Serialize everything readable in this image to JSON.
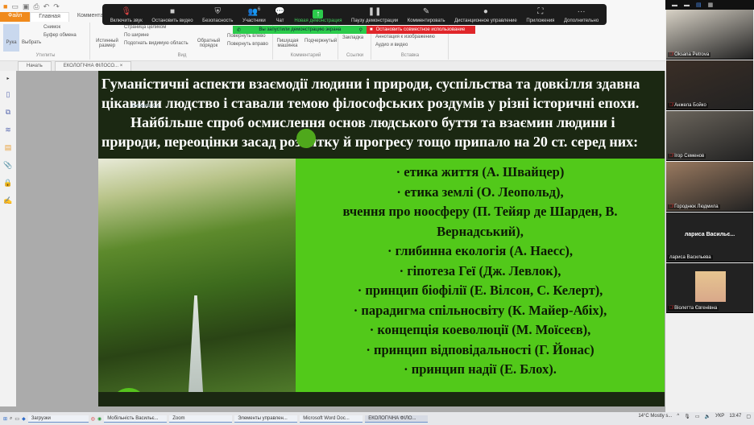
{
  "ribbon": {
    "tabs": [
      "Файл",
      "Главная",
      "Комментарий"
    ],
    "tools": {
      "hand": "Рука",
      "select": "Выбрать",
      "snapshot": "Снимок",
      "clipboard": "Буфер обмена",
      "group": "Утилиты"
    },
    "view": {
      "actual_size": "Истинный размер",
      "full_page": "Страница целиком",
      "fit_width": "По ширине",
      "fit_visible": "Подогнать видимую область",
      "reverse": "Обратный порядок",
      "rotate_left": "Повернуть влево",
      "rotate_right": "Повернуть вправо",
      "group": "Вид"
    },
    "comment": {
      "typewriter": "Пишущая машинка",
      "highlight": "Подчеркнутый",
      "group": "Комментарий"
    },
    "links": {
      "bookmark": "Закладка",
      "group": "Ссылки"
    },
    "insert": {
      "annotation": "Аннотация к изображению",
      "audio": "Аудио и видео",
      "group": "Вставка"
    }
  },
  "zoom_toolbar": {
    "items": [
      "Включить звук",
      "Остановить видео",
      "Безопасность",
      "Участники",
      "Чат",
      "Новая демонстрация",
      "Паузу демонстрации",
      "Комментировать",
      "Дистанционное управление",
      "Приложения",
      "Дополнительно"
    ],
    "participants_count": "6",
    "share_banner": "Вы запустили демонстрацию экрана",
    "stop_share": "Остановить совместное использование"
  },
  "doc_tabs": [
    "Начать",
    "ЕКОЛОГІЧНА ФІЛОСО..."
  ],
  "slide": {
    "head": [
      "Гуманістичні аспекти взаємодії людини і природи, суспільства та довкілля здавна цікавили людство і ставали темою філософських роздумів у різні історичні епохи.",
      "Найбільше спроб осмислення основ людського буття та взаємин людини і природи, переоцінки засад розвитку й прогресу тощо припало на 20 ст. серед них:"
    ],
    "logo": "Bimberia Co",
    "items": [
      "·     етика життя (А. Швайцер)",
      "·     етика землі (О. Леопольд),",
      "вчення про ноосферу (П. Тейяр де Шарден, В. Вернадський),",
      "·     глибинна екологія (А. Наесс),",
      "·     гіпотеза Геї (Дж. Левлок),",
      "·     принцип біофілії (Е. Вілсон, С. Келерт),",
      "·     парадигма спільносвіту (К. Майер-Абіх),",
      "·     концепція коеволюції (М. Моїсеєв),",
      "·     принцип відповідальності (Г. Йонас)",
      "·     принцип надії (Е. Блох)."
    ]
  },
  "participants": [
    {
      "name": "Oksana Petrova",
      "muted": true,
      "color": "#d8d2c6"
    },
    {
      "name": "Анжела Бойко",
      "muted": true,
      "color": "#3a2e26"
    },
    {
      "name": "Ігор Семенов",
      "muted": true,
      "color": "#6b655c"
    },
    {
      "name": "Городнюк Людмила",
      "muted": true,
      "color": "#9a7a60"
    },
    {
      "name": "лариса Васильева",
      "muted": false,
      "big": "лариса  Васильє...",
      "color": "#222222"
    },
    {
      "name": "Віолетта Євгенівна",
      "muted": true,
      "color": "#222222"
    }
  ],
  "taskbar": {
    "apps": [
      "Загрузки",
      "Мобільність Васильє...",
      "Zoom",
      "Элементы управлен...",
      "Microsoft Word Doc...",
      "ЕКОЛОГІЧНА ФІЛО..."
    ],
    "weather": "14°C  Mostly s...",
    "lang": "УКР",
    "time": "13:47"
  }
}
